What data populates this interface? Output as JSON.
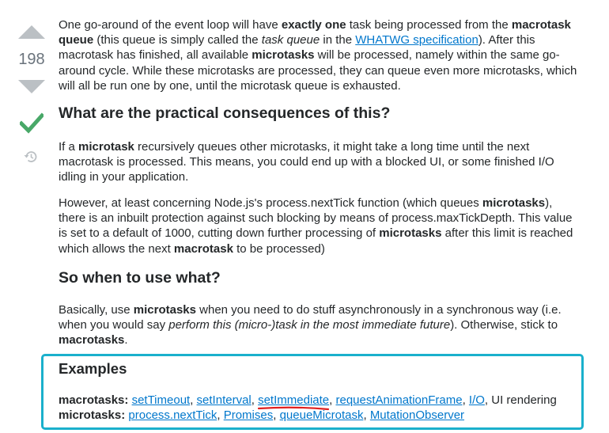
{
  "vote": {
    "count": "198"
  },
  "paragraph1": {
    "t1": "One go-around of the event loop will have ",
    "b1": "exactly one",
    "t2": " task being processed from the ",
    "b2": "macrotask queue",
    "t3": " (this queue is simply called the ",
    "i1": "task queue",
    "t4": " in the ",
    "link": "WHATWG specification",
    "t5": "). After this macrotask has finished, all available ",
    "b3": "microtasks",
    "t6": " will be processed, namely within the same go-around cycle. While these microtasks are processed, they can queue even more microtasks, which will all be run one by one, until the microtask queue is exhausted."
  },
  "heading1": "What are the practical consequences of this?",
  "paragraph2": {
    "t1": "If a ",
    "b1": "microtask",
    "t2": " recursively queues other microtasks, it might take a long time until the next macrotask is processed. This means, you could end up with a blocked UI, or some finished I/O idling in your application."
  },
  "paragraph3": {
    "t1": "However, at least concerning Node.js's process.nextTick function (which queues ",
    "b1": "microtasks",
    "t2": "), there is an inbuilt protection against such blocking by means of process.maxTickDepth. This value is set to a default of 1000, cutting down further processing of ",
    "b2": "microtasks",
    "t3": " after this limit is reached which allows the next ",
    "b3": "macrotask",
    "t4": " to be processed)"
  },
  "heading2": "So when to use what?",
  "paragraph4": {
    "t1": "Basically, use ",
    "b1": "microtasks",
    "t2": " when you need to do stuff asynchronously in a synchronous way (i.e. when you would say ",
    "i1": "perform this (micro-)task in the most immediate future",
    "t3": "). Otherwise, stick to ",
    "b2": "macrotasks",
    "t4": "."
  },
  "examples": {
    "title": "Examples",
    "macro_label": "macrotasks:",
    "macro_links": [
      "setTimeout",
      "setInterval",
      "setImmediate",
      "requestAnimationFrame",
      "I/O"
    ],
    "macro_tail": "UI rendering",
    "micro_label": "microtasks:",
    "micro_links": [
      "process.nextTick",
      "Promises",
      "queueMicrotask",
      "MutationObserver"
    ]
  },
  "colors": {
    "link": "#0077cc",
    "accent_box": "#1ab0cc",
    "accepted": "#48a868",
    "underline_mark": "#e02020"
  }
}
